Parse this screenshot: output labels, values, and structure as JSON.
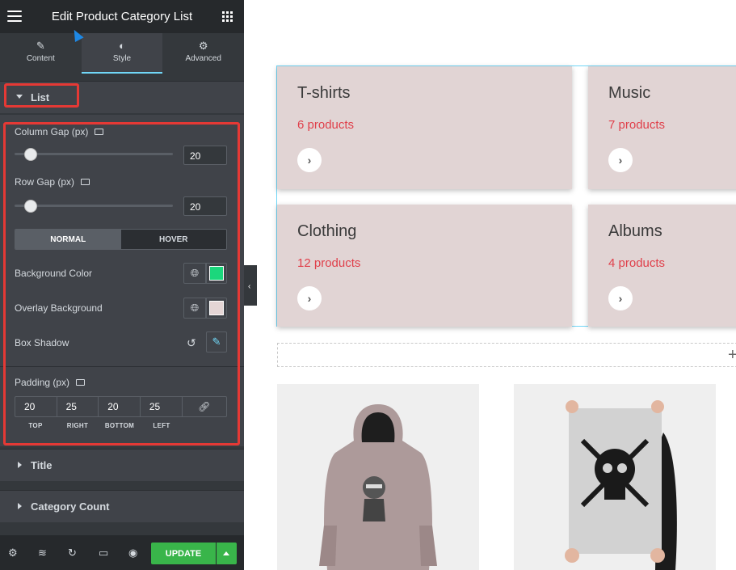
{
  "editor": {
    "title": "Edit Product Category List",
    "tabs": [
      {
        "label": "Content",
        "icon": "pencil-icon"
      },
      {
        "label": "Style",
        "icon": "contrast-icon"
      },
      {
        "label": "Advanced",
        "icon": "gear-icon"
      }
    ],
    "sections": {
      "list": "List",
      "title": "Title",
      "category_count": "Category Count"
    },
    "controls": {
      "column_gap_label": "Column Gap (px)",
      "column_gap_value": "20",
      "column_gap_fraction": 0.2,
      "row_gap_label": "Row Gap (px)",
      "row_gap_value": "20",
      "row_gap_fraction": 0.2,
      "state_normal": "NORMAL",
      "state_hover": "HOVER",
      "background_color_label": "Background Color",
      "background_color": "#1bd77c",
      "overlay_background_label": "Overlay Background",
      "overlay_background_color": "#e5d5d5",
      "box_shadow_label": "Box Shadow",
      "padding_label": "Padding (px)",
      "padding": {
        "top": "20",
        "right": "25",
        "bottom": "20",
        "left": "25"
      },
      "padding_labels": {
        "top": "TOP",
        "right": "RIGHT",
        "bottom": "BOTTOM",
        "left": "LEFT"
      }
    },
    "footer": {
      "update_label": "UPDATE"
    }
  },
  "preview": {
    "categories": [
      {
        "name": "T-shirts",
        "count": "6 products"
      },
      {
        "name": "Music",
        "count": "7 products"
      },
      {
        "name": "Clothing",
        "count": "12 products"
      },
      {
        "name": "Albums",
        "count": "4 products"
      }
    ],
    "accent_color": "#e0404b",
    "card_color": "#e1d4d4"
  }
}
